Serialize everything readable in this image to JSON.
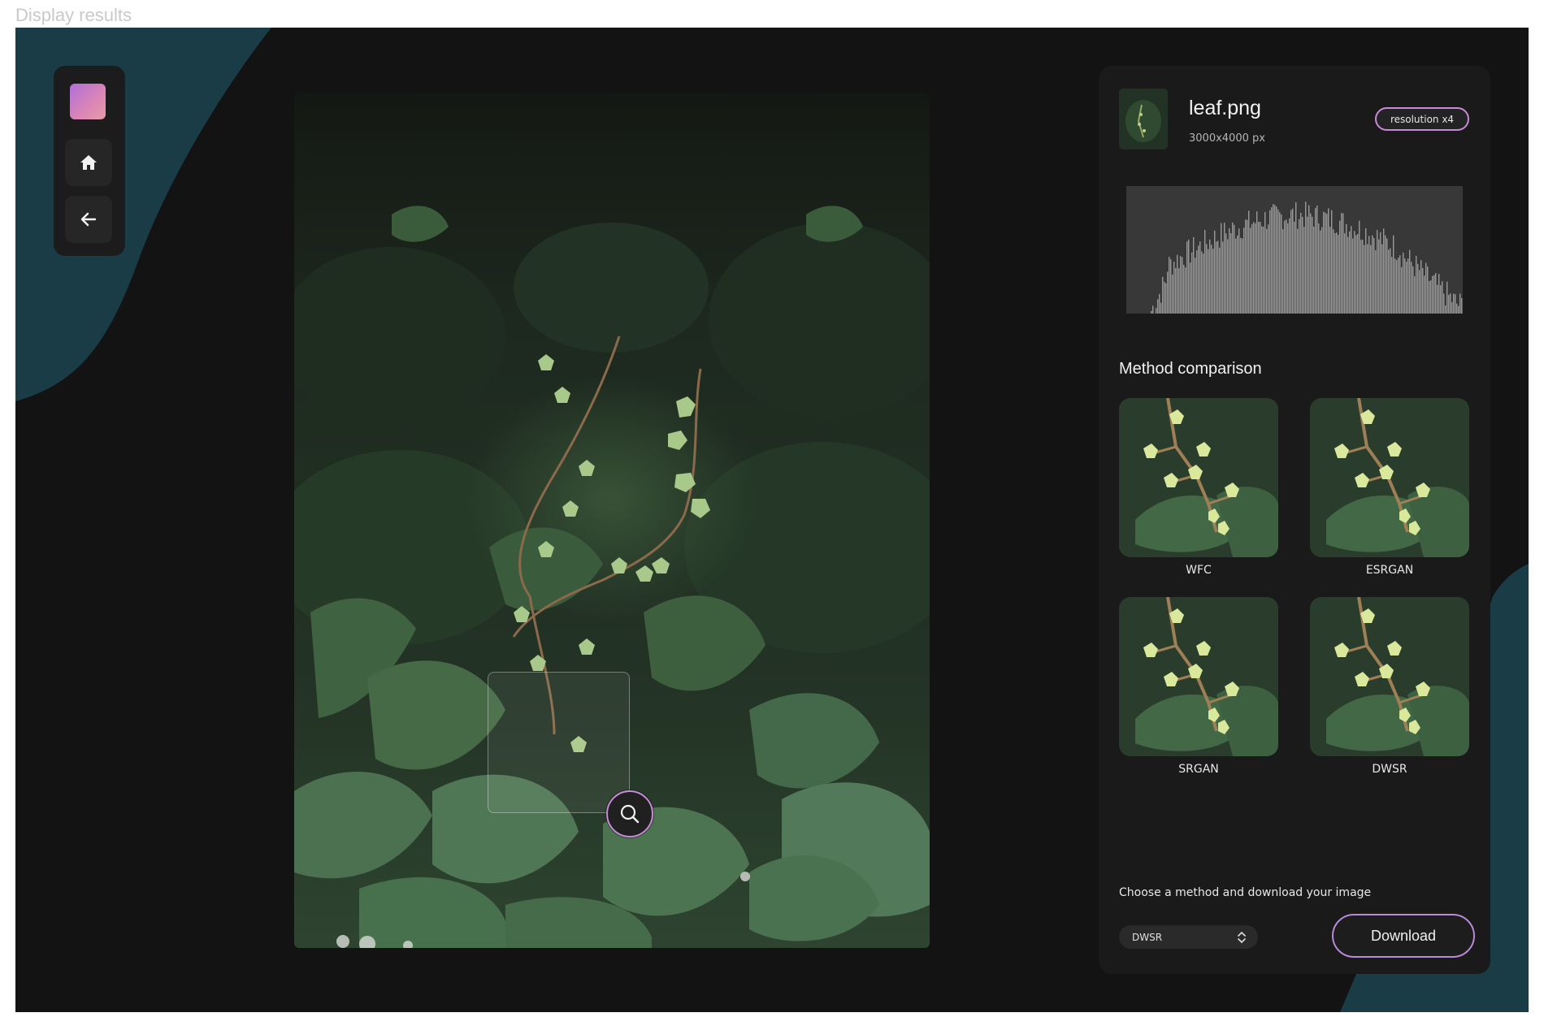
{
  "page_label": "Display results",
  "sidebar": {
    "logo_icon": "gradient-square-logo",
    "items": [
      {
        "icon": "home-icon",
        "label": "home"
      },
      {
        "icon": "back-arrow-icon",
        "label": "back"
      }
    ]
  },
  "image_view": {
    "image": "leaf photo",
    "zoom_icon": "magnifier-icon"
  },
  "file": {
    "name": "leaf.png",
    "dimensions": "3000x4000 px",
    "badge": "resolution x4"
  },
  "comparison": {
    "title": "Method comparison",
    "methods": [
      {
        "label": "WFC"
      },
      {
        "label": "ESRGAN"
      },
      {
        "label": "SRGAN"
      },
      {
        "label": "DWSR"
      }
    ]
  },
  "download_section": {
    "instruction": "Choose a method and download your image",
    "selected_method": "DWSR",
    "button_label": "Download"
  },
  "colors": {
    "background": "#131313",
    "blob": "#1a3c46",
    "panel": "#1a1a1a",
    "accent": "#c88ad6"
  }
}
